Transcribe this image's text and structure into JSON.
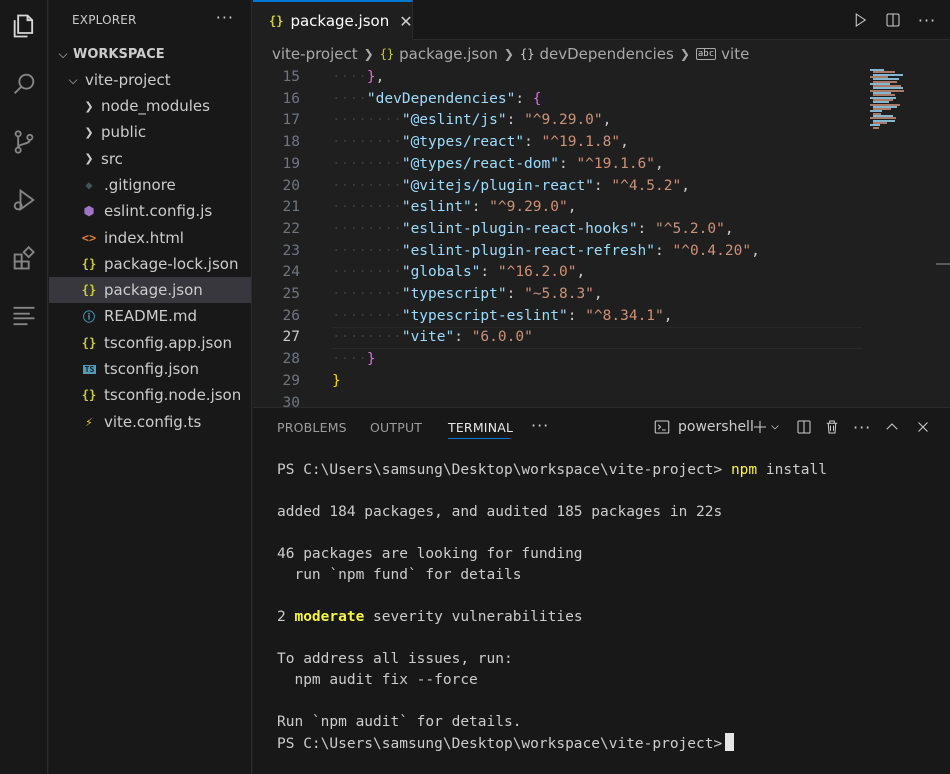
{
  "explorer": {
    "title": "EXPLORER",
    "more": "···",
    "workspace_label": "WORKSPACE",
    "project_label": "vite-project",
    "items": [
      {
        "label": "node_modules",
        "kind": "folder",
        "icon": "chevron-right-icon"
      },
      {
        "label": "public",
        "kind": "folder",
        "icon": "chevron-right-icon"
      },
      {
        "label": "src",
        "kind": "folder",
        "icon": "chevron-right-icon"
      },
      {
        "label": ".gitignore",
        "kind": "file",
        "icon": "git-icon",
        "glyph": "◆",
        "color": "#41535b"
      },
      {
        "label": "eslint.config.js",
        "kind": "file",
        "icon": "eslint-icon",
        "glyph": "⬢",
        "color": "#a074c4"
      },
      {
        "label": "index.html",
        "kind": "file",
        "icon": "html-icon",
        "glyph": "<>",
        "color": "#e37933"
      },
      {
        "label": "package-lock.json",
        "kind": "file",
        "icon": "json-icon",
        "glyph": "{}",
        "color": "#cbcb41"
      },
      {
        "label": "package.json",
        "kind": "file",
        "icon": "json-icon",
        "glyph": "{}",
        "color": "#cbcb41",
        "selected": true
      },
      {
        "label": "README.md",
        "kind": "file",
        "icon": "info-icon",
        "glyph": "ⓘ",
        "color": "#519aba"
      },
      {
        "label": "tsconfig.app.json",
        "kind": "file",
        "icon": "json-icon",
        "glyph": "{}",
        "color": "#cbcb41"
      },
      {
        "label": "tsconfig.json",
        "kind": "file",
        "icon": "typescript-config-icon",
        "glyph": "TS",
        "color": "#519aba"
      },
      {
        "label": "tsconfig.node.json",
        "kind": "file",
        "icon": "json-icon",
        "glyph": "{}",
        "color": "#cbcb41"
      },
      {
        "label": "vite.config.ts",
        "kind": "file",
        "icon": "vite-icon",
        "glyph": "⚡",
        "color": "#ffd62e"
      }
    ]
  },
  "tab": {
    "label": "package.json",
    "icon_glyph": "{}",
    "close": "✕"
  },
  "breadcrumb": {
    "items": [
      "vite-project",
      "package.json",
      "devDependencies",
      "vite"
    ],
    "icons": [
      "",
      "{}",
      "{}",
      "abc"
    ]
  },
  "editor": {
    "current_line": 27,
    "lines": [
      {
        "n": "15",
        "indent": 1,
        "tokens": [
          [
            "p2",
            "}"
          ],
          [
            "pun",
            ","
          ]
        ]
      },
      {
        "n": "16",
        "indent": 1,
        "tokens": [
          [
            "key",
            "\"devDependencies\""
          ],
          [
            "pun",
            ": "
          ],
          [
            "p2",
            "{"
          ]
        ]
      },
      {
        "n": "17",
        "indent": 2,
        "tokens": [
          [
            "key",
            "\"@eslint/js\""
          ],
          [
            "pun",
            ": "
          ],
          [
            "str",
            "\"^9.29.0\""
          ],
          [
            "pun",
            ","
          ]
        ]
      },
      {
        "n": "18",
        "indent": 2,
        "tokens": [
          [
            "key",
            "\"@types/react\""
          ],
          [
            "pun",
            ": "
          ],
          [
            "str",
            "\"^19.1.8\""
          ],
          [
            "pun",
            ","
          ]
        ]
      },
      {
        "n": "19",
        "indent": 2,
        "tokens": [
          [
            "key",
            "\"@types/react-dom\""
          ],
          [
            "pun",
            ": "
          ],
          [
            "str",
            "\"^19.1.6\""
          ],
          [
            "pun",
            ","
          ]
        ]
      },
      {
        "n": "20",
        "indent": 2,
        "tokens": [
          [
            "key",
            "\"@vitejs/plugin-react\""
          ],
          [
            "pun",
            ": "
          ],
          [
            "str",
            "\"^4.5.2\""
          ],
          [
            "pun",
            ","
          ]
        ]
      },
      {
        "n": "21",
        "indent": 2,
        "tokens": [
          [
            "key",
            "\"eslint\""
          ],
          [
            "pun",
            ": "
          ],
          [
            "str",
            "\"^9.29.0\""
          ],
          [
            "pun",
            ","
          ]
        ]
      },
      {
        "n": "22",
        "indent": 2,
        "tokens": [
          [
            "key",
            "\"eslint-plugin-react-hooks\""
          ],
          [
            "pun",
            ": "
          ],
          [
            "str",
            "\"^5.2.0\""
          ],
          [
            "pun",
            ","
          ]
        ]
      },
      {
        "n": "23",
        "indent": 2,
        "tokens": [
          [
            "key",
            "\"eslint-plugin-react-refresh\""
          ],
          [
            "pun",
            ": "
          ],
          [
            "str",
            "\"^0.4.20\""
          ],
          [
            "pun",
            ","
          ]
        ]
      },
      {
        "n": "24",
        "indent": 2,
        "tokens": [
          [
            "key",
            "\"globals\""
          ],
          [
            "pun",
            ": "
          ],
          [
            "str",
            "\"^16.2.0\""
          ],
          [
            "pun",
            ","
          ]
        ]
      },
      {
        "n": "25",
        "indent": 2,
        "tokens": [
          [
            "key",
            "\"typescript\""
          ],
          [
            "pun",
            ": "
          ],
          [
            "str",
            "\"~5.8.3\""
          ],
          [
            "pun",
            ","
          ]
        ]
      },
      {
        "n": "26",
        "indent": 2,
        "tokens": [
          [
            "key",
            "\"typescript-eslint\""
          ],
          [
            "pun",
            ": "
          ],
          [
            "str",
            "\"^8.34.1\""
          ],
          [
            "pun",
            ","
          ]
        ]
      },
      {
        "n": "27",
        "indent": 2,
        "tokens": [
          [
            "key",
            "\"vite\""
          ],
          [
            "pun",
            ": "
          ],
          [
            "str",
            "\"6.0.0\""
          ]
        ]
      },
      {
        "n": "28",
        "indent": 1,
        "tokens": [
          [
            "p2",
            "}"
          ]
        ]
      },
      {
        "n": "29",
        "indent": 0,
        "tokens": [
          [
            "p1",
            "}"
          ]
        ]
      },
      {
        "n": "30",
        "indent": 0,
        "tokens": []
      }
    ]
  },
  "panel": {
    "tabs": [
      "PROBLEMS",
      "OUTPUT",
      "TERMINAL"
    ],
    "active_tab": "TERMINAL",
    "more": "···",
    "shell_label": "powershell"
  },
  "terminal": {
    "prompt": "PS C:\\Users\\samsung\\Desktop\\workspace\\vite-project>",
    "command_name": "npm",
    "command_args": "install",
    "added_line": "added 184 packages, and audited 185 packages in 22s",
    "funding_line1": "46 packages are looking for funding",
    "funding_line2": "  run `npm fund` for details",
    "vuln_count": "2",
    "vuln_severity": "moderate",
    "vuln_rest": "severity vulnerabilities",
    "fix_line1": "To address all issues, run:",
    "fix_line2": "  npm audit fix --force",
    "details_line": "Run `npm audit` for details.",
    "final_prompt": "PS C:\\Users\\samsung\\Desktop\\workspace\\vite-project>"
  }
}
